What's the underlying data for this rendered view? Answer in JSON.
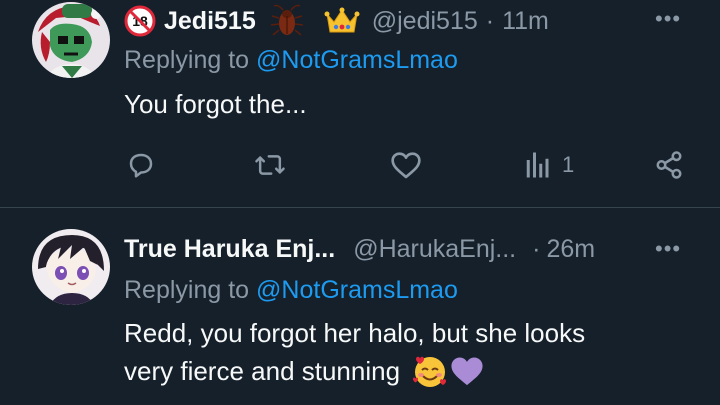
{
  "tweet1": {
    "display_name": "Jedi515",
    "badge_18": "18",
    "handle": "@jedi515",
    "separator": "·",
    "time": "11m",
    "replying_prefix": "Replying to",
    "replying_to": "@NotGramsLmao",
    "text": "You forgot the...",
    "views_count": "1",
    "icons": [
      "no-18-badge-icon",
      "cockroach-emoji-icon",
      "crown-emoji-icon",
      "more-options-icon",
      "reply-icon",
      "retweet-icon",
      "like-icon",
      "views-icon",
      "share-icon"
    ]
  },
  "tweet2": {
    "display_name": "True Haruka Enj...",
    "handle": "@HarukaEnj...",
    "separator": "·",
    "time": "26m",
    "replying_prefix": "Replying to",
    "replying_to": "@NotGramsLmao",
    "text_line1": "Redd, you forgot her halo, but she looks",
    "text_line2": "very fierce and stunning",
    "icons": [
      "smiling-face-with-hearts-emoji-icon",
      "purple-heart-emoji-icon",
      "more-options-icon"
    ]
  },
  "colors": {
    "background": "#15202b",
    "link": "#1d9bf0",
    "muted": "#8b98a5",
    "divider": "#38444d"
  }
}
